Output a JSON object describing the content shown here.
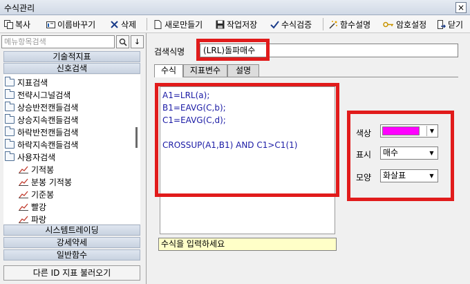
{
  "window": {
    "title": "수식관리",
    "close_glyph": "×"
  },
  "toolbar": {
    "items": [
      {
        "label": "복사",
        "icon": "copy-icon"
      },
      {
        "label": "이름바꾸기",
        "icon": "rename-icon"
      },
      {
        "label": "삭제",
        "icon": "delete-icon"
      },
      {
        "label": "새로만들기",
        "icon": "new-document-icon"
      },
      {
        "label": "작업저장",
        "icon": "save-icon"
      },
      {
        "label": "수식검증",
        "icon": "check-icon"
      },
      {
        "label": "함수설명",
        "icon": "sparkle-icon"
      },
      {
        "label": "암호설정",
        "icon": "key-icon"
      },
      {
        "label": "닫기",
        "icon": "exit-icon"
      }
    ]
  },
  "sidebar": {
    "search_placeholder": "메뉴항목검색",
    "search_glyph": "🔍",
    "down_glyph": "↓",
    "categories_top": [
      "기술적지표",
      "신호검색"
    ],
    "tree": [
      {
        "label": "지표검색",
        "type": "folder",
        "level": 0
      },
      {
        "label": "전략시그널검색",
        "type": "folder",
        "level": 0
      },
      {
        "label": "상승반전캔들검색",
        "type": "folder",
        "level": 0
      },
      {
        "label": "상승지속캔들검색",
        "type": "folder",
        "level": 0
      },
      {
        "label": "하락반전캔들검색",
        "type": "folder",
        "level": 0
      },
      {
        "label": "하락지속캔들검색",
        "type": "folder",
        "level": 0
      },
      {
        "label": "사용자검색",
        "type": "folder",
        "level": 0
      },
      {
        "label": "기적봉",
        "type": "chart",
        "level": 1
      },
      {
        "label": "분봉 기적봉",
        "type": "chart",
        "level": 1
      },
      {
        "label": "기준봉",
        "type": "chart",
        "level": 1
      },
      {
        "label": "빨강",
        "type": "chart",
        "level": 1
      },
      {
        "label": "파랑",
        "type": "chart",
        "level": 1
      }
    ],
    "categories_bottom": [
      "시스템트레이딩",
      "강세약세",
      "일반함수"
    ],
    "load_button": "다른 ID 지표 불러오기"
  },
  "main": {
    "name_label": "검색식명",
    "name_value": "(LRL)돌파매수",
    "tabs": [
      "수식",
      "지표변수",
      "설명"
    ],
    "active_tab": 0,
    "formula_lines": [
      "A1=LRL(a);",
      "B1=EAVG(C,b);",
      "C1=EAVG(C,d);",
      "",
      "CROSSUP(A1,B1) AND C1>C1(1)"
    ],
    "hint_text": "수식을 입력하세요",
    "color_label": "색상",
    "color_value": "#ff00ff",
    "display_label": "표시",
    "display_value": "매수",
    "shape_label": "모양",
    "shape_value": "화살표",
    "dropdown_glyph": "▼"
  },
  "colors": {
    "highlight_box": "#e11b1b",
    "formula_text": "#1a1aa5",
    "hint_bg": "#ffffc8"
  }
}
